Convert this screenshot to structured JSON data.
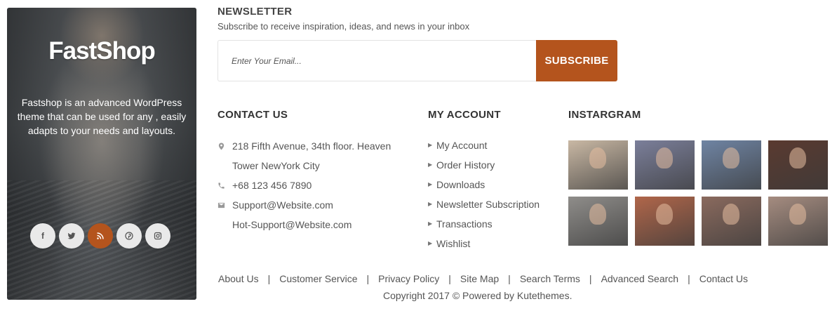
{
  "brand": {
    "title": "FastShop",
    "description": "Fastshop is an advanced WordPress theme that can be used for any , easily adapts to your needs and layouts.",
    "social": [
      {
        "icon": "facebook-icon",
        "glyph": "f"
      },
      {
        "icon": "twitter-icon",
        "glyph": ""
      },
      {
        "icon": "rss-icon",
        "glyph": ""
      },
      {
        "icon": "pinterest-icon",
        "glyph": ""
      },
      {
        "icon": "instagram-icon",
        "glyph": ""
      }
    ],
    "accent_color": "#b4541d"
  },
  "newsletter": {
    "title": "NEWSLETTER",
    "subtitle": "Subscribe to receive inspiration, ideas, and news in your inbox",
    "email_placeholder": "Enter Your Email...",
    "email_value": "",
    "button_label": "SUBSCRIBE",
    "button_color": "#b4541d"
  },
  "contact": {
    "title": "CONTACT US",
    "items": [
      {
        "icon": "map-pin-icon",
        "text": "218 Fifth Avenue, 34th floor. Heaven"
      },
      {
        "icon": "",
        "text": "Tower NewYork City"
      },
      {
        "icon": "phone-icon",
        "text": "+68 123 456 7890"
      },
      {
        "icon": "envelope-icon",
        "text": "Support@Website.com"
      },
      {
        "icon": "",
        "text": "Hot-Support@Website.com"
      }
    ]
  },
  "account": {
    "title": "MY ACCOUNT",
    "items": [
      "My Account",
      "Order History",
      "Downloads",
      "Newsletter Subscription",
      "Transactions",
      "Wishlist"
    ]
  },
  "instagram": {
    "title": "INSTARGRAM",
    "photos": [
      {
        "subject": "two-women-photo",
        "bg": "#c9b8a4"
      },
      {
        "subject": "woman-street-photo",
        "bg": "#7b7f9a"
      },
      {
        "subject": "man-brick-wall-photo",
        "bg": "#6f84a3"
      },
      {
        "subject": "woman-sunglasses-photo",
        "bg": "#5a3a30"
      },
      {
        "subject": "man-suit-photo",
        "bg": "#8f8d8a"
      },
      {
        "subject": "woman-brick-photo",
        "bg": "#b0664a"
      },
      {
        "subject": "couple-photo",
        "bg": "#8a6a5e"
      },
      {
        "subject": "blonde-woman-photo",
        "bg": "#a58c80"
      }
    ]
  },
  "footer": {
    "links": [
      "About Us",
      "Customer Service",
      "Privacy Policy",
      "Site Map",
      "Search Terms",
      "Advanced Search",
      "Contact Us"
    ],
    "separator": "|",
    "copyright": "Copyright 2017 © Powered by Kutethemes."
  }
}
